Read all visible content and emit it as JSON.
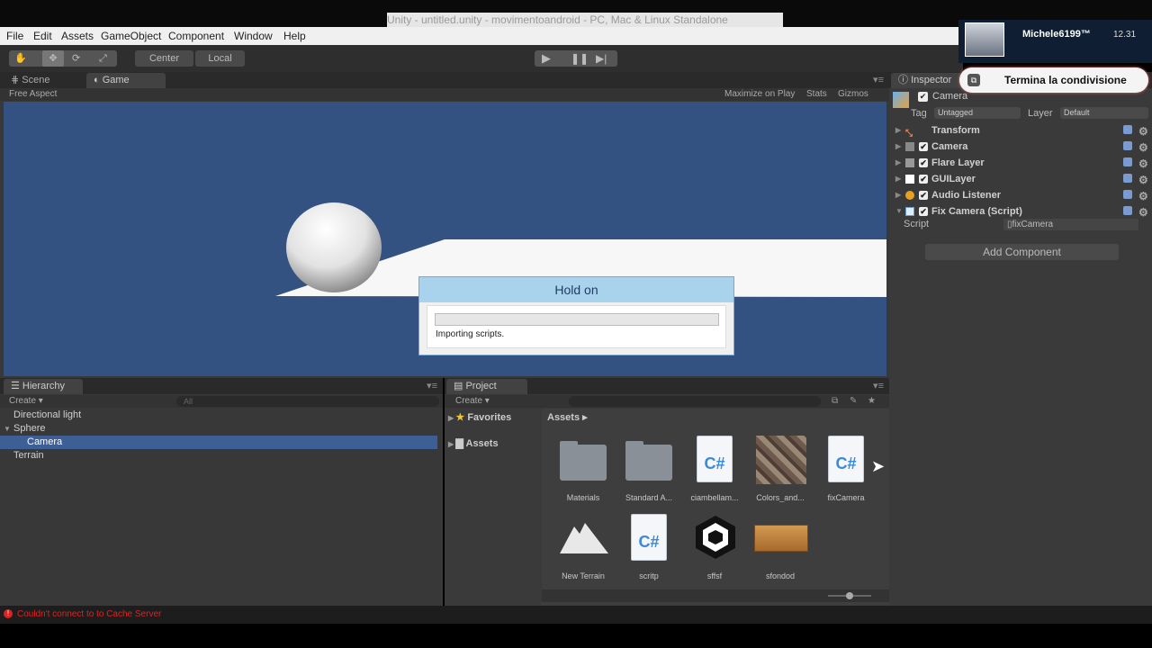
{
  "window": {
    "title": "Unity - untitled.unity - movimentoandroid - PC, Mac & Linux Standalone"
  },
  "menu": [
    "File",
    "Edit",
    "Assets",
    "GameObject",
    "Component",
    "Window",
    "Help"
  ],
  "toolbar": {
    "center_label": "Center",
    "local_label": "Local"
  },
  "scene_tabs": {
    "scene": "Scene",
    "game": "Game"
  },
  "game_view": {
    "aspect": "Free Aspect",
    "maximize": "Maximize on Play",
    "stats": "Stats",
    "gizmos": "Gizmos"
  },
  "dialog": {
    "title": "Hold on",
    "message": "Importing scripts.",
    "progress": 0.0
  },
  "hierarchy": {
    "tab": "Hierarchy",
    "create": "Create",
    "search_placeholder": "All",
    "items": [
      {
        "label": "Directional light"
      },
      {
        "label": "Sphere"
      },
      {
        "label": "Camera"
      },
      {
        "label": "Terrain"
      }
    ]
  },
  "project": {
    "tab": "Project",
    "create": "Create",
    "favorites": "Favorites",
    "assets_root": "Assets",
    "breadcrumb": "Assets",
    "assets": [
      {
        "name": "Materials",
        "icon": "folder-icon"
      },
      {
        "name": "Standard A...",
        "icon": "folder-icon"
      },
      {
        "name": "ciambellam...",
        "icon": "csharp-script-icon"
      },
      {
        "name": "Colors_and...",
        "icon": "texture-icon"
      },
      {
        "name": "fixCamera",
        "icon": "csharp-script-icon"
      },
      {
        "name": "New Terrain",
        "icon": "terrain-icon"
      },
      {
        "name": "scritp",
        "icon": "csharp-script-icon"
      },
      {
        "name": "sffsf",
        "icon": "unity-scene-icon"
      },
      {
        "name": "sfondod",
        "icon": "material-icon"
      }
    ]
  },
  "inspector": {
    "tab": "Inspector",
    "object_name": "Camera",
    "tag_label": "Tag",
    "tag_value": "Untagged",
    "layer_label": "Layer",
    "layer_value": "Default",
    "components": [
      {
        "name": "Transform",
        "checkbox": false
      },
      {
        "name": "Camera",
        "checkbox": true
      },
      {
        "name": "Flare Layer",
        "checkbox": true
      },
      {
        "name": "GUILayer",
        "checkbox": true
      },
      {
        "name": "Audio Listener",
        "checkbox": true
      },
      {
        "name": "Fix Camera (Script)",
        "checkbox": true
      }
    ],
    "script_label": "Script",
    "script_value": "fixCamera",
    "add_component": "Add Component"
  },
  "share_overlay": {
    "user": "Michele6199™",
    "time": "12.31",
    "stop_label": "Termina la condivisione"
  },
  "status": {
    "error": "Couldn't connect to to Cache Server"
  },
  "colors": {
    "scene_bg": "#335181",
    "selection": "#3e5f96",
    "error": "#d22"
  }
}
